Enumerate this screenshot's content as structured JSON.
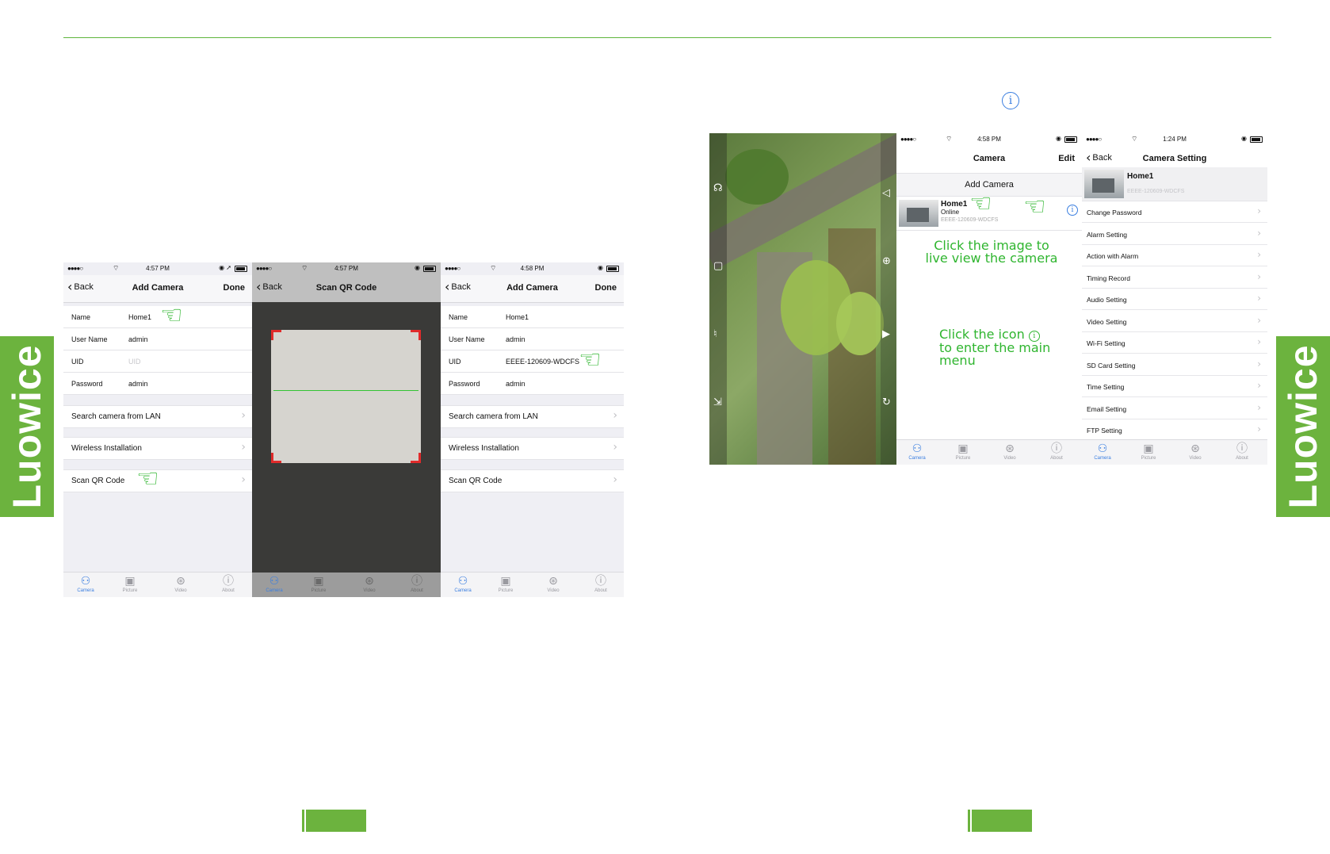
{
  "brand": {
    "side_label": "Luowice",
    "accent_color": "#6cb33e"
  },
  "screen1": {
    "status_time": "4:57 PM",
    "nav": {
      "back": "Back",
      "title": "Add Camera",
      "right": "Done"
    },
    "fields": [
      {
        "label": "Name",
        "value": "Home1"
      },
      {
        "label": "User Name",
        "value": "admin"
      },
      {
        "label": "UID",
        "placeholder": "UID"
      },
      {
        "label": "Password",
        "value": "admin"
      }
    ],
    "menu": [
      "Search camera from LAN",
      "Wireless Installation",
      "Scan QR Code"
    ]
  },
  "screen2": {
    "status_time": "4:57 PM",
    "nav": {
      "back": "Back",
      "title": "Scan QR Code"
    }
  },
  "screen3": {
    "status_time": "4:58 PM",
    "nav": {
      "back": "Back",
      "title": "Add Camera",
      "right": "Done"
    },
    "fields": [
      {
        "label": "Name",
        "value": "Home1"
      },
      {
        "label": "User Name",
        "value": "admin"
      },
      {
        "label": "UID",
        "value": "EEEE-120609-WDCFS"
      },
      {
        "label": "Password",
        "value": "admin"
      }
    ],
    "menu": [
      "Search camera from LAN",
      "Wireless Installation",
      "Scan QR Code"
    ]
  },
  "tabs": [
    "Camera",
    "Picture",
    "Video",
    "About"
  ],
  "camera_list": {
    "status_time": "4:58 PM",
    "nav": {
      "title": "Camera",
      "right": "Edit"
    },
    "add_label": "Add Camera",
    "item": {
      "name": "Home1",
      "status": "Online",
      "uid": "EEEE-120609-WDCFS"
    },
    "note1": [
      "Click the image to",
      "live view the camera"
    ],
    "note2_line1": "Click the icon",
    "note2_line2": "to enter the main menu"
  },
  "camera_setting": {
    "status_time": "1:24 PM",
    "nav": {
      "back": "Back",
      "title": "Camera Setting"
    },
    "header": {
      "name": "Home1",
      "uid": "EEEE-120609-WDCFS"
    },
    "items": [
      "Change Password",
      "Alarm Setting",
      "Action with Alarm",
      "Timing Record",
      "Audio Setting",
      "Video Setting",
      "Wi-Fi Setting",
      "SD Card Setting",
      "Time Setting",
      "Email Setting",
      "FTP Setting"
    ]
  }
}
